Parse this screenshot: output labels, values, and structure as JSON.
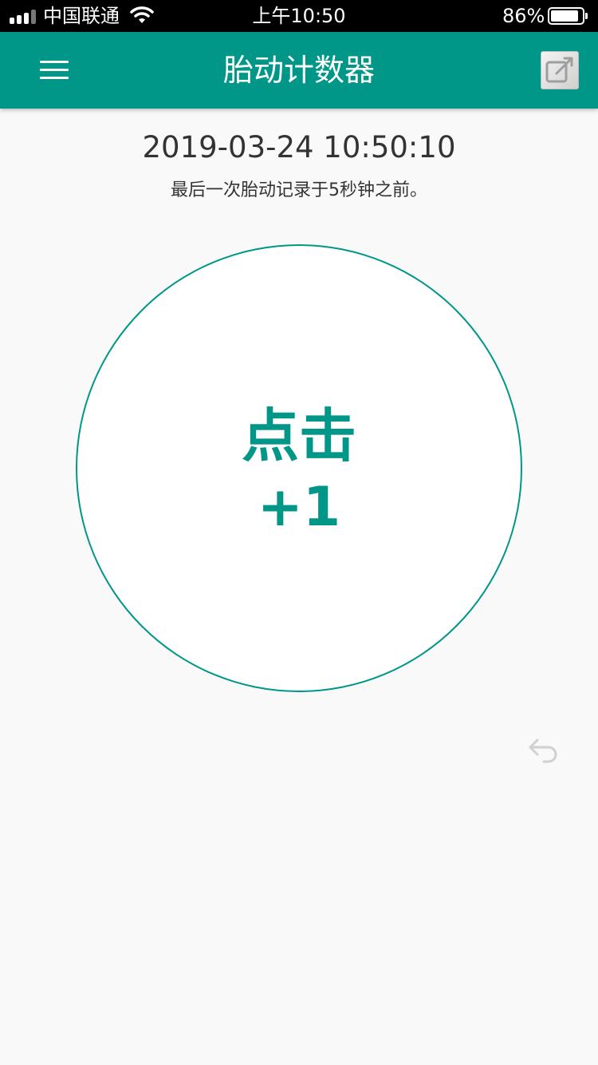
{
  "status_bar": {
    "carrier": "中国联通",
    "time": "上午10:50",
    "battery": "86%"
  },
  "app_bar": {
    "title": "胎动计数器"
  },
  "main": {
    "datetime": "2019-03-24 10:50:10",
    "last_record": "最后一次胎动记录于5秒钟之前。",
    "tap_button": {
      "label": "点击",
      "increment": "+1"
    }
  },
  "colors": {
    "primary": "#009688",
    "background": "#f9f9f9"
  },
  "icons": [
    "signal-icon",
    "wifi-icon",
    "battery-icon",
    "menu-icon",
    "edit-icon",
    "undo-icon"
  ]
}
